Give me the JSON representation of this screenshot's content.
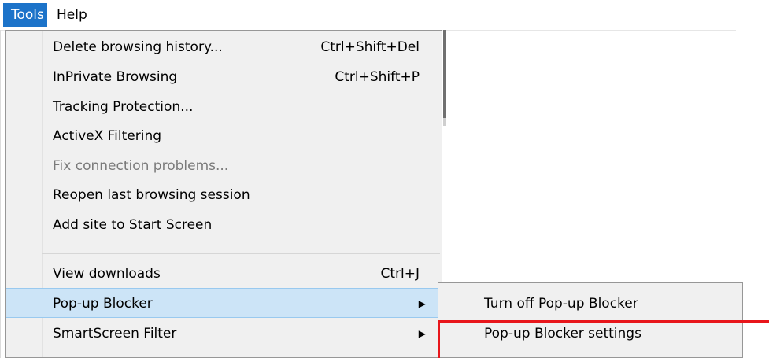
{
  "menubar": {
    "items": [
      {
        "label": "Tools"
      },
      {
        "label": "Help"
      }
    ]
  },
  "tools_menu": {
    "items": [
      {
        "label": "Delete browsing history...",
        "shortcut": "Ctrl+Shift+Del"
      },
      {
        "label": "InPrivate Browsing",
        "shortcut": "Ctrl+Shift+P"
      },
      {
        "label": "Tracking Protection..."
      },
      {
        "label": "ActiveX Filtering"
      },
      {
        "label": "Fix connection problems...",
        "disabled": true
      },
      {
        "label": "Reopen last browsing session"
      },
      {
        "label": "Add site to Start Screen"
      },
      {
        "label": "View downloads",
        "shortcut": "Ctrl+J"
      },
      {
        "label": "Pop-up Blocker",
        "has_submenu": true,
        "highlighted": true
      },
      {
        "label": "SmartScreen Filter",
        "has_submenu": true
      }
    ]
  },
  "popup_blocker_submenu": {
    "items": [
      {
        "label": "Turn off Pop-up Blocker"
      },
      {
        "label": "Pop-up Blocker settings"
      }
    ]
  },
  "colors": {
    "accent": "#1c73c9",
    "highlight": "#cce4f7",
    "annotation": "#e8161b"
  },
  "icons": {
    "submenu_arrow": "chevron-right-icon"
  }
}
